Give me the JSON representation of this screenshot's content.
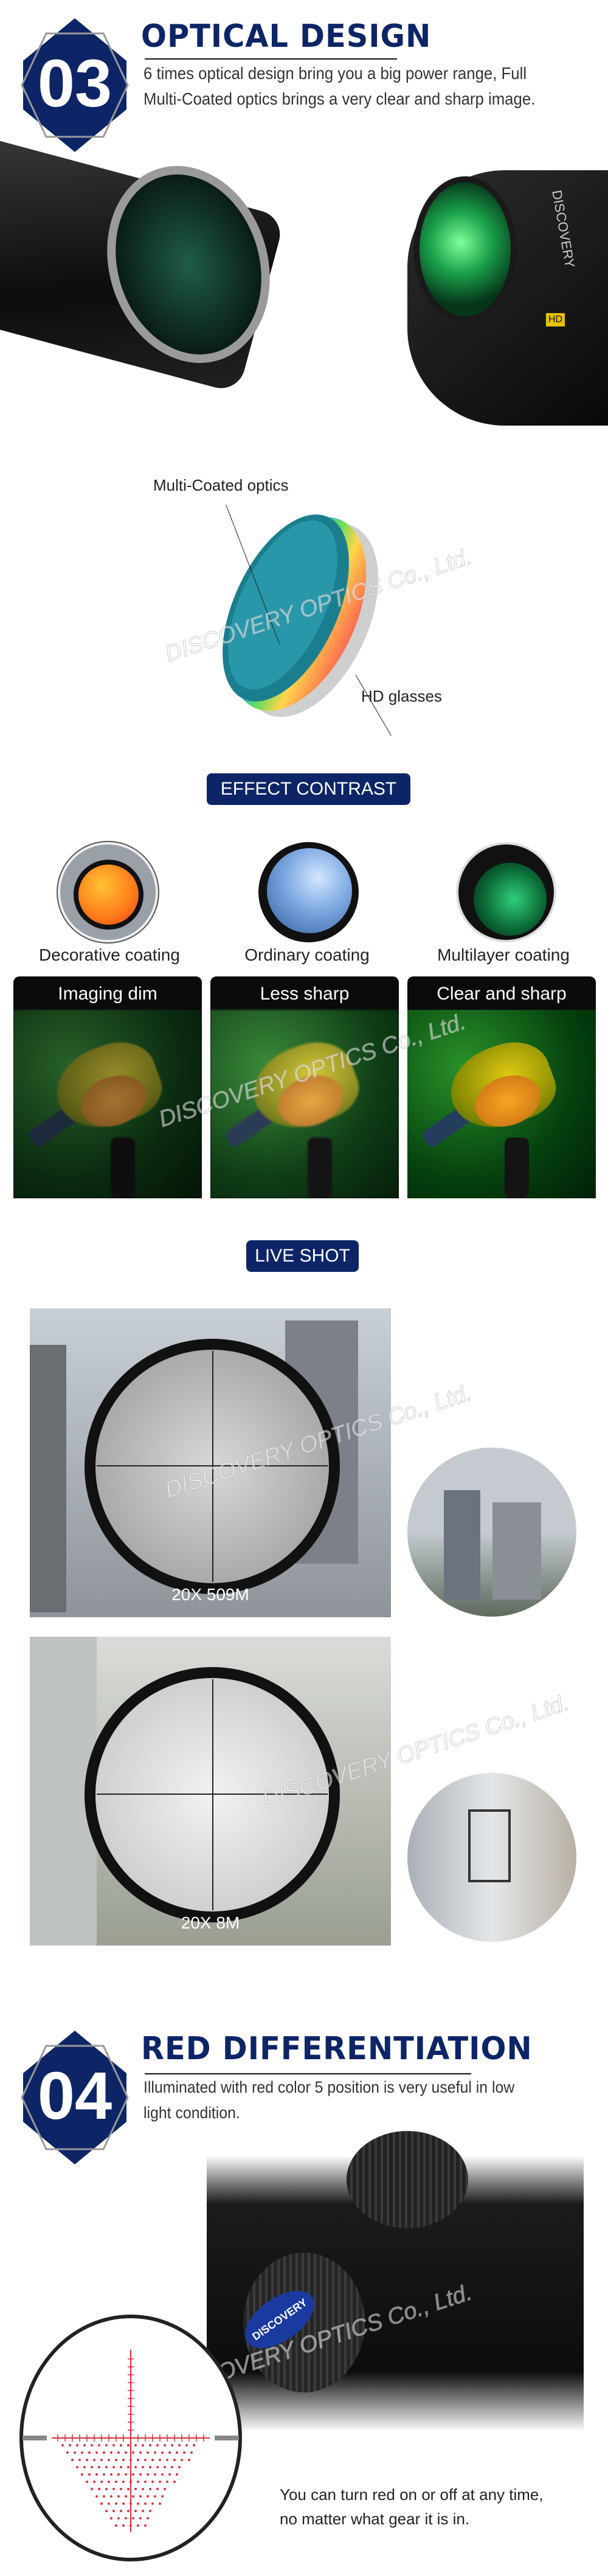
{
  "section03": {
    "number": "03",
    "title": "OPTICAL DESIGN",
    "description_lines": [
      "6 times optical design bring you a big power range, Full",
      "Multi-Coated optics brings a very clear and sharp image."
    ]
  },
  "scope_brand": "DISCOVERY",
  "scope_hd": "HD",
  "lens_diagram": {
    "label_top": "Multi-Coated optics",
    "label_bottom": "HD glasses"
  },
  "watermark": "DISCOVERY OPTICS Co., Ltd.",
  "effect_contrast": {
    "badge": "EFFECT CONTRAST",
    "coatings": [
      {
        "label": "Decorative coating",
        "result": "Imaging dim"
      },
      {
        "label": "Ordinary coating",
        "result": "Less sharp"
      },
      {
        "label": "Multilayer coating",
        "result": "Clear and sharp"
      }
    ]
  },
  "live_shot": {
    "badge": "LIVE SHOT",
    "shots": [
      {
        "caption": "20X 509M"
      },
      {
        "caption": "20X 8M"
      }
    ]
  },
  "section04": {
    "number": "04",
    "title": "RED DIFFERENTIATION",
    "description_lines": [
      "Illuminated with red color 5 position is very useful in low",
      "light condition."
    ],
    "callout_lines": [
      "You can turn red on or off at any time,",
      "no matter what gear it is in."
    ]
  },
  "colors": {
    "brand_navy": "#0d2566",
    "reticle_red": "#d9303a"
  }
}
